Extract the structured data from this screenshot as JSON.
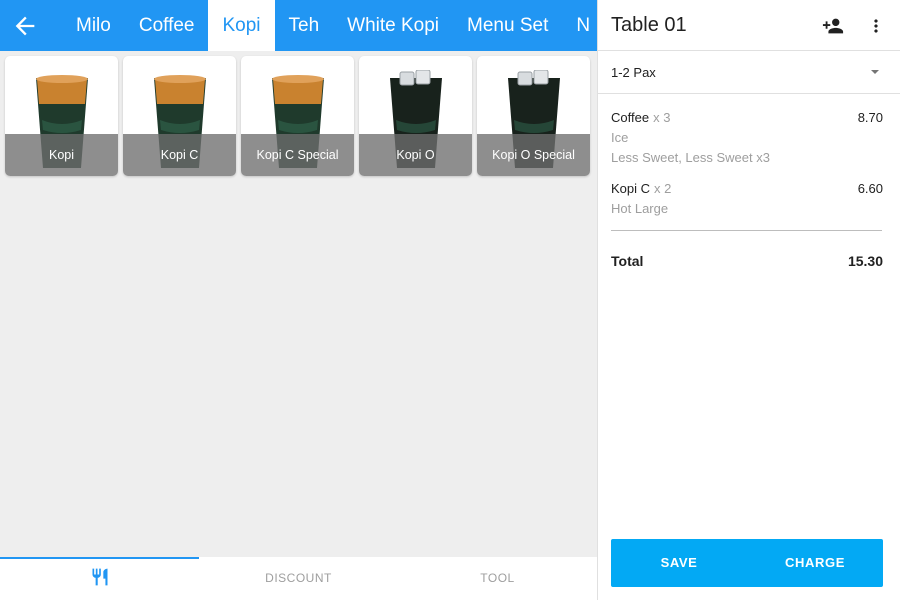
{
  "colors": {
    "primary": "#2196f3",
    "action": "#03a9f4"
  },
  "topbar": {
    "back_icon": "arrow-left-icon",
    "tabs": [
      "Milo",
      "Coffee",
      "Kopi",
      "Teh",
      "White Kopi",
      "Menu Set",
      "N"
    ],
    "active_tab": "Kopi"
  },
  "products": [
    {
      "name": "Kopi",
      "drink": "milk-coffee"
    },
    {
      "name": "Kopi C",
      "drink": "milk-coffee"
    },
    {
      "name": "Kopi C Special",
      "drink": "milk-coffee"
    },
    {
      "name": "Kopi O",
      "drink": "black-coffee"
    },
    {
      "name": "Kopi O Special",
      "drink": "black-coffee"
    }
  ],
  "bottom_nav": {
    "menu_icon": "fork-knife-icon",
    "discount": "DISCOUNT",
    "tool": "TOOL",
    "active": "menu"
  },
  "order": {
    "title": "Table 01",
    "header_icons": [
      "add-person-icon",
      "more-vert-icon"
    ],
    "pax": "1-2 Pax",
    "items": [
      {
        "name": "Coffee",
        "qty": "x 3",
        "price": "8.70",
        "modifiers": [
          "Ice",
          "Less Sweet, Less Sweet x3"
        ]
      },
      {
        "name": "Kopi C",
        "qty": "x 2",
        "price": "6.60",
        "modifiers": [
          "Hot Large"
        ]
      }
    ],
    "total_label": "Total",
    "total_value": "15.30",
    "save_label": "SAVE",
    "charge_label": "CHARGE"
  }
}
